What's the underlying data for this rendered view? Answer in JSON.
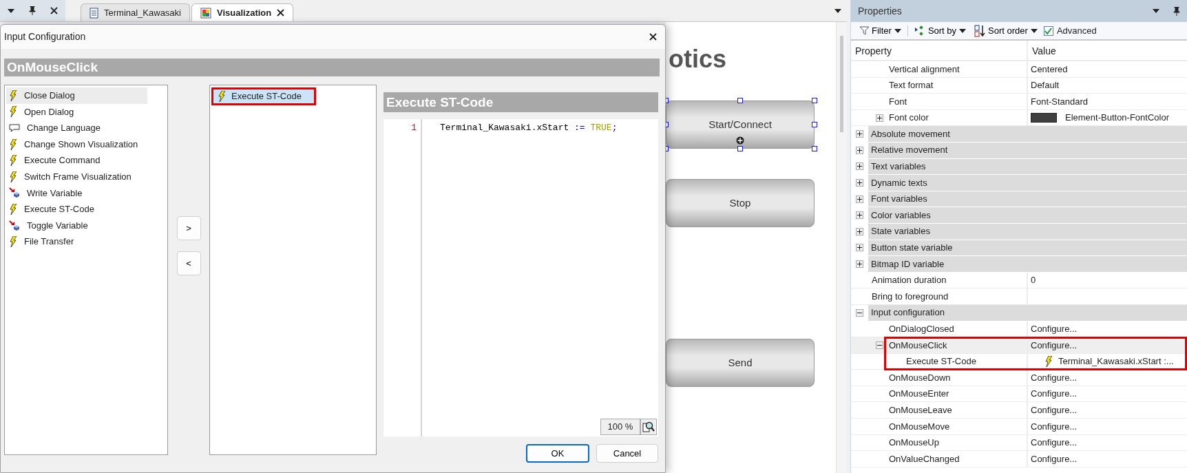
{
  "tabs": [
    {
      "label": "Terminal_Kawasaki",
      "kind": "program",
      "selected": false
    },
    {
      "label": "Visualization",
      "kind": "visualization",
      "selected": true
    }
  ],
  "canvas": {
    "heading": "otics",
    "buttons": [
      {
        "label": "Start/Connect",
        "selected": true
      },
      {
        "label": "Stop",
        "selected": false
      },
      {
        "label": "Send",
        "selected": false
      }
    ]
  },
  "dialog": {
    "title": "Input Configuration",
    "header": "OnMouseClick",
    "available_actions": [
      {
        "label": "Close Dialog",
        "kind": "action",
        "selected": true
      },
      {
        "label": "Open Dialog",
        "kind": "action",
        "selected": false
      },
      {
        "label": "Change Language",
        "kind": "language",
        "selected": false
      },
      {
        "label": "Change Shown Visualization",
        "kind": "action",
        "selected": false
      },
      {
        "label": "Execute Command",
        "kind": "action",
        "selected": false
      },
      {
        "label": "Switch Frame Visualization",
        "kind": "action",
        "selected": false
      },
      {
        "label": "Write Variable",
        "kind": "variable",
        "selected": false
      },
      {
        "label": "Execute ST-Code",
        "kind": "action",
        "selected": false
      },
      {
        "label": "Toggle Variable",
        "kind": "variable",
        "selected": false
      },
      {
        "label": "File Transfer",
        "kind": "action",
        "selected": false
      }
    ],
    "move_buttons": [
      ">",
      "<"
    ],
    "configured_actions": [
      {
        "label": "Execute ST-Code",
        "kind": "action",
        "selected": true,
        "highlighted": true
      }
    ],
    "editor": {
      "title": "Execute ST-Code",
      "lines": [
        {
          "number": "1",
          "tokens": [
            {
              "text": "Terminal_Kawasaki",
              "kind": "ident"
            },
            {
              "text": ".",
              "kind": "op"
            },
            {
              "text": "xStart",
              "kind": "ident"
            },
            {
              "text": " := ",
              "kind": "op"
            },
            {
              "text": "TRUE",
              "kind": "keyword"
            },
            {
              "text": ";",
              "kind": "op"
            }
          ]
        }
      ],
      "zoom": "100 %"
    },
    "buttons": [
      {
        "label": "OK",
        "default": true
      },
      {
        "label": "Cancel",
        "default": false
      }
    ]
  },
  "properties": {
    "title": "Properties",
    "toolbar": {
      "filter": "Filter",
      "sort_by": "Sort by",
      "sort_order": "Sort order",
      "advanced": {
        "label": "Advanced",
        "checked": true
      }
    },
    "columns": [
      "Property",
      "Value"
    ],
    "scrolled_group_rows": [
      {
        "kind": "prop",
        "label": "Vertical alignment",
        "value": "Centered"
      },
      {
        "kind": "prop",
        "label": "Text format",
        "value": "Default"
      },
      {
        "kind": "prop",
        "label": "Font",
        "value": "Font-Standard"
      },
      {
        "kind": "prop",
        "label": "Font color",
        "value": "Element-Button-FontColor",
        "color": "#404040",
        "expanded": false
      }
    ],
    "rows": [
      {
        "kind": "group",
        "label": "Absolute movement",
        "expanded": false
      },
      {
        "kind": "group",
        "label": "Relative movement",
        "expanded": false
      },
      {
        "kind": "group",
        "label": "Text variables",
        "expanded": false
      },
      {
        "kind": "group",
        "label": "Dynamic texts",
        "expanded": false
      },
      {
        "kind": "group",
        "label": "Font variables",
        "expanded": false
      },
      {
        "kind": "group",
        "label": "Color variables",
        "expanded": false
      },
      {
        "kind": "group",
        "label": "State variables",
        "expanded": false
      },
      {
        "kind": "group",
        "label": "Button state variable",
        "expanded": false
      },
      {
        "kind": "group",
        "label": "Bitmap ID variable",
        "expanded": false
      },
      {
        "kind": "prop",
        "label": "Animation duration",
        "value": "0"
      },
      {
        "kind": "prop",
        "label": "Bring to foreground"
      },
      {
        "kind": "group",
        "label": "Input configuration",
        "expanded": true,
        "children": [
          {
            "kind": "prop",
            "label": "OnDialogClosed",
            "value": "Configure...",
            "selected": false
          },
          {
            "kind": "prop",
            "label": "OnMouseClick",
            "value": "Configure...",
            "selected": true,
            "expanded": true,
            "highlighted": true,
            "children": [
              {
                "kind": "action",
                "label": "Execute ST-Code",
                "value": "Terminal_Kawasaki.xStart :..."
              }
            ]
          },
          {
            "kind": "prop",
            "label": "OnMouseDown",
            "value": "Configure...",
            "selected": false
          },
          {
            "kind": "prop",
            "label": "OnMouseEnter",
            "value": "Configure...",
            "selected": false
          },
          {
            "kind": "prop",
            "label": "OnMouseLeave",
            "value": "Configure...",
            "selected": false
          },
          {
            "kind": "prop",
            "label": "OnMouseMove",
            "value": "Configure...",
            "selected": false
          },
          {
            "kind": "prop",
            "label": "OnMouseUp",
            "value": "Configure...",
            "selected": false
          },
          {
            "kind": "prop",
            "label": "OnValueChanged",
            "value": "Configure...",
            "selected": false
          }
        ]
      }
    ]
  }
}
